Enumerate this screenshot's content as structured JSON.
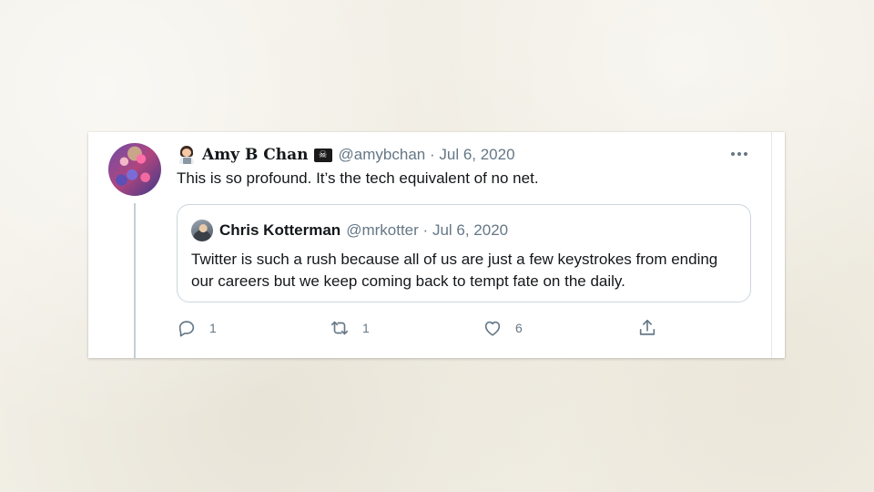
{
  "tweet": {
    "display_name": "Amy B Chan",
    "handle": "@amybchan",
    "separator": "·",
    "date": "Jul 6, 2020",
    "text": "This is so profound. It’s the tech equivalent of no net.",
    "name_emoji_before": "woman-technologist-icon",
    "name_emoji_after": "pirate-flag-icon"
  },
  "quoted_tweet": {
    "display_name": "Chris Kotterman",
    "handle": "@mrkotter",
    "separator": "·",
    "date": "Jul 6, 2020",
    "text": "Twitter is such a rush because all of us are just a few keystrokes from ending our careers but we keep coming back to tempt fate on the daily."
  },
  "actions": {
    "reply_count": "1",
    "retweet_count": "1",
    "like_count": "6"
  },
  "colors": {
    "text_primary": "#14171a",
    "text_secondary": "#657786",
    "border": "#ccd6dd"
  }
}
